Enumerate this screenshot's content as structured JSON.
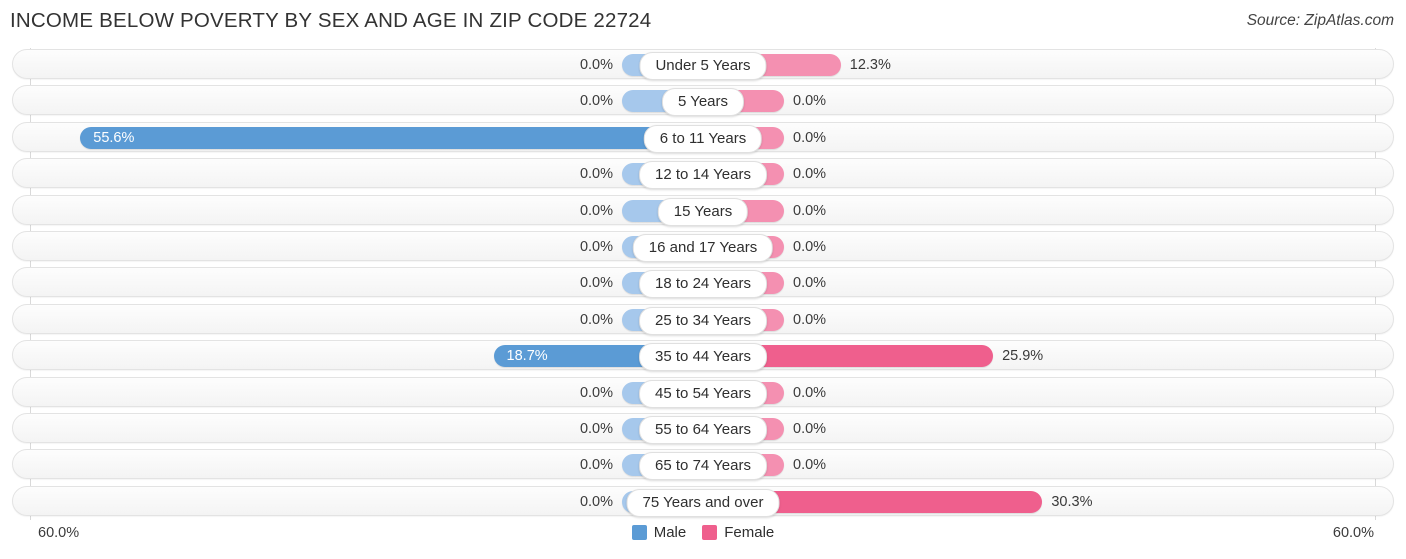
{
  "header": {
    "title": "INCOME BELOW POVERTY BY SEX AND AGE IN ZIP CODE 22724",
    "source": "Source: ZipAtlas.com"
  },
  "axis": {
    "left_tick": "60.0%",
    "right_tick": "60.0%",
    "max": 60.0
  },
  "legend": {
    "male_label": "Male",
    "female_label": "Female",
    "male_color": "#5b9bd5",
    "female_color": "#ef5f8d"
  },
  "colors": {
    "male_light": "#a6c8ec",
    "male_strong": "#5b9bd5",
    "female_light": "#f490b1",
    "female_strong": "#ef5f8d",
    "row_track": "#f4f4f4",
    "row_border": "#e3e3e3"
  },
  "chart_data": {
    "type": "bar",
    "title": "INCOME BELOW POVERTY BY SEX AND AGE IN ZIP CODE 22724",
    "subtitle": "",
    "xlabel": "",
    "ylabel": "",
    "orientation": "horizontal-diverging",
    "xlim": [
      60.0,
      60.0
    ],
    "grid": false,
    "legend_position": "bottom-center",
    "categories": [
      "Under 5 Years",
      "5 Years",
      "6 to 11 Years",
      "12 to 14 Years",
      "15 Years",
      "16 and 17 Years",
      "18 to 24 Years",
      "25 to 34 Years",
      "35 to 44 Years",
      "45 to 54 Years",
      "55 to 64 Years",
      "65 to 74 Years",
      "75 Years and over"
    ],
    "series": [
      {
        "name": "Male",
        "values": [
          0.0,
          0.0,
          55.6,
          0.0,
          0.0,
          0.0,
          0.0,
          0.0,
          18.7,
          0.0,
          0.0,
          0.0,
          0.0
        ],
        "labels": [
          "0.0%",
          "0.0%",
          "55.6%",
          "0.0%",
          "0.0%",
          "0.0%",
          "0.0%",
          "0.0%",
          "18.7%",
          "0.0%",
          "0.0%",
          "0.0%",
          "0.0%"
        ]
      },
      {
        "name": "Female",
        "values": [
          12.3,
          0.0,
          0.0,
          0.0,
          0.0,
          0.0,
          0.0,
          0.0,
          25.9,
          0.0,
          0.0,
          0.0,
          30.3
        ],
        "labels": [
          "12.3%",
          "0.0%",
          "0.0%",
          "0.0%",
          "0.0%",
          "0.0%",
          "0.0%",
          "0.0%",
          "25.9%",
          "0.0%",
          "0.0%",
          "0.0%",
          "30.3%"
        ]
      }
    ]
  }
}
